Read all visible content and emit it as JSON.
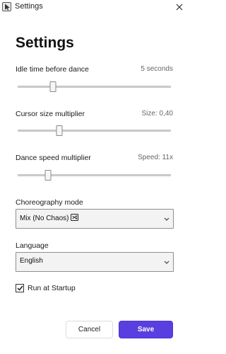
{
  "window": {
    "title": "Settings",
    "app_icon": "cursor-app-icon",
    "close_icon": "close-icon"
  },
  "page": {
    "title": "Settings"
  },
  "idle_time": {
    "label": "Idle time before dance",
    "value_text": "5 seconds",
    "slider_fraction": 0.23
  },
  "cursor_size": {
    "label": "Cursor size multiplier",
    "value_text": "Size: 0,40",
    "slider_fraction": 0.27
  },
  "dance_speed": {
    "label": "Dance speed multiplier",
    "value_text": "Speed: 11x",
    "slider_fraction": 0.2
  },
  "choreography": {
    "label": "Choreography mode",
    "selected": "Mix (No Chaos)",
    "icon": "shuffle-icon"
  },
  "language": {
    "label": "Language",
    "selected": "English"
  },
  "startup": {
    "label": "Run at Startup",
    "checked": true
  },
  "actions": {
    "cancel_label": "Cancel",
    "save_label": "Save"
  },
  "colors": {
    "accent": "#5a3fe0"
  }
}
